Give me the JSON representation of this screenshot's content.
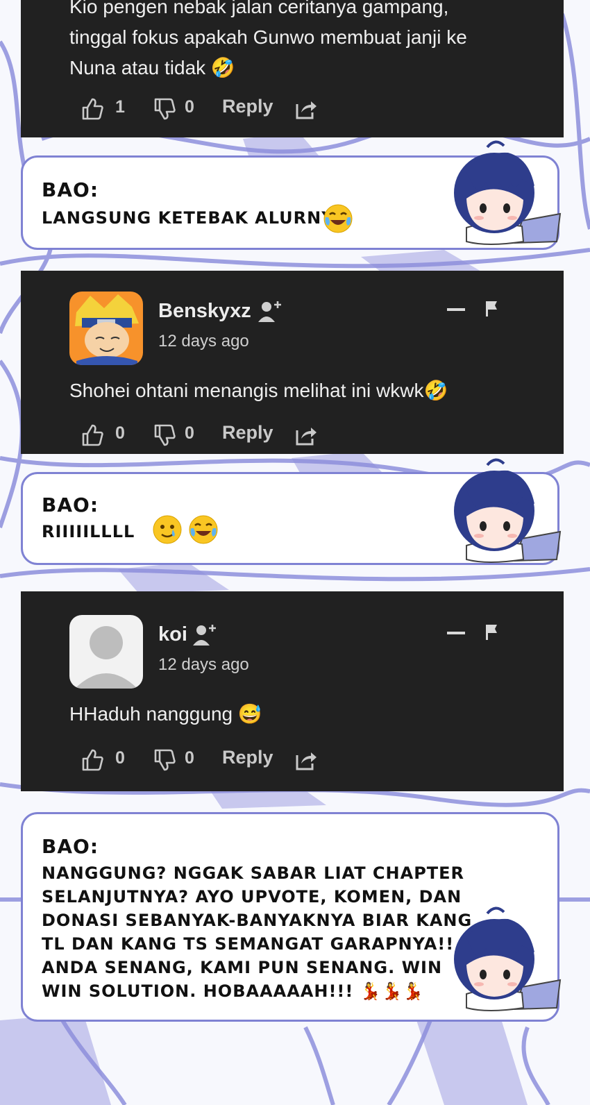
{
  "comments": [
    {
      "text_lines": [
        "Kio pengen nebak jalan ceritanya gampang,",
        "tinggal fokus apakah Gunwo membuat janji ke",
        "Nuna atau tidak 🤣"
      ],
      "likes": "1",
      "dislikes": "0",
      "reply_label": "Reply"
    },
    {
      "username": "Benskyxz",
      "time": "12 days ago",
      "text": "Shohei ohtani menangis melihat ini wkwk🤣",
      "likes": "0",
      "dislikes": "0",
      "reply_label": "Reply"
    },
    {
      "username": "koi",
      "time": "12 days ago",
      "text": "HHaduh nanggung 😅",
      "likes": "0",
      "dislikes": "0",
      "reply_label": "Reply"
    }
  ],
  "bao_notes": [
    {
      "speaker": "BAO:",
      "text": "LANGSUNG KETEBAK ALURNYA"
    },
    {
      "speaker": "BAO:",
      "text": "RIIIIILLLL"
    },
    {
      "speaker": "BAO:",
      "text_lines": [
        "NANGGUNG? NGGAK SABAR LIAT CHAPTER",
        "SELANJUTNYA? AYO UPVOTE, KOMEN, DAN",
        "DONASI SEBANYAK-BANYAKNYA BIAR KANG",
        "TL DAN KANG TS SEMANGAT GARAPNYA!!",
        "ANDA SENANG, KAMI PUN SENANG. WIN",
        "WIN SOLUTION. HOBAAAAAH!!! 💃💃💃"
      ]
    }
  ],
  "colors": {
    "card_bg": "#212121",
    "bubble_border": "#7f82d3",
    "background_art": "#8d8fdc"
  }
}
